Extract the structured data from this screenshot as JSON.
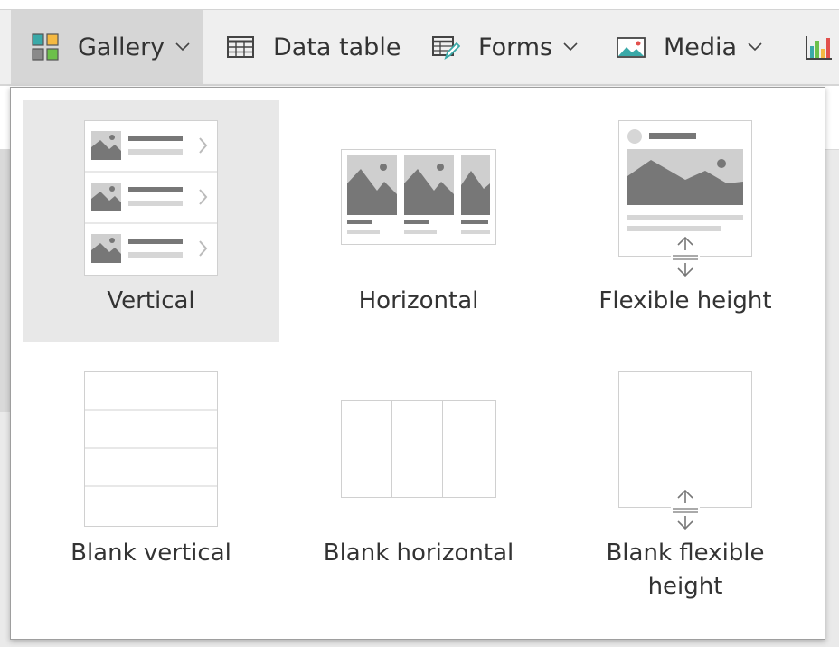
{
  "toolbar": {
    "items": [
      {
        "label": "Gallery",
        "icon": "gallery-icon",
        "has_dropdown": true,
        "active": true
      },
      {
        "label": "Data table",
        "icon": "data-table-icon",
        "has_dropdown": false,
        "active": false
      },
      {
        "label": "Forms",
        "icon": "forms-icon",
        "has_dropdown": true,
        "active": false
      },
      {
        "label": "Media",
        "icon": "media-icon",
        "has_dropdown": true,
        "active": false
      },
      {
        "label": "",
        "icon": "chart-icon",
        "has_dropdown": false,
        "active": false
      }
    ]
  },
  "gallery_menu": {
    "options": [
      {
        "label": "Vertical",
        "selected": true
      },
      {
        "label": "Horizontal",
        "selected": false
      },
      {
        "label": "Flexible height",
        "selected": false
      },
      {
        "label": "Blank vertical",
        "selected": false
      },
      {
        "label": "Blank horizontal",
        "selected": false
      },
      {
        "label": "Blank flexible height",
        "label_lines": [
          "Blank flexible",
          "height"
        ],
        "selected": false
      }
    ]
  },
  "colors": {
    "active_tab": "#d6d6d6",
    "selected_tile": "#e8e8e8",
    "image_dark": "#777777",
    "image_light": "#cfcfcf",
    "border": "#d0d0d0"
  }
}
